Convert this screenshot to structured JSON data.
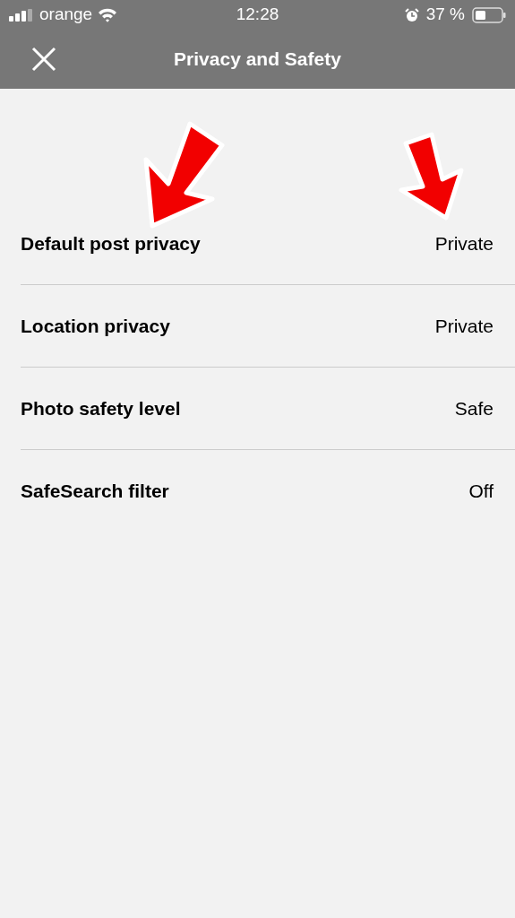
{
  "status_bar": {
    "carrier": "orange",
    "time": "12:28",
    "battery": "37 %"
  },
  "header": {
    "title": "Privacy and Safety"
  },
  "settings": [
    {
      "label": "Default post privacy",
      "value": "Private"
    },
    {
      "label": "Location privacy",
      "value": "Private"
    },
    {
      "label": "Photo safety level",
      "value": "Safe"
    },
    {
      "label": "SafeSearch filter",
      "value": "Off"
    }
  ]
}
